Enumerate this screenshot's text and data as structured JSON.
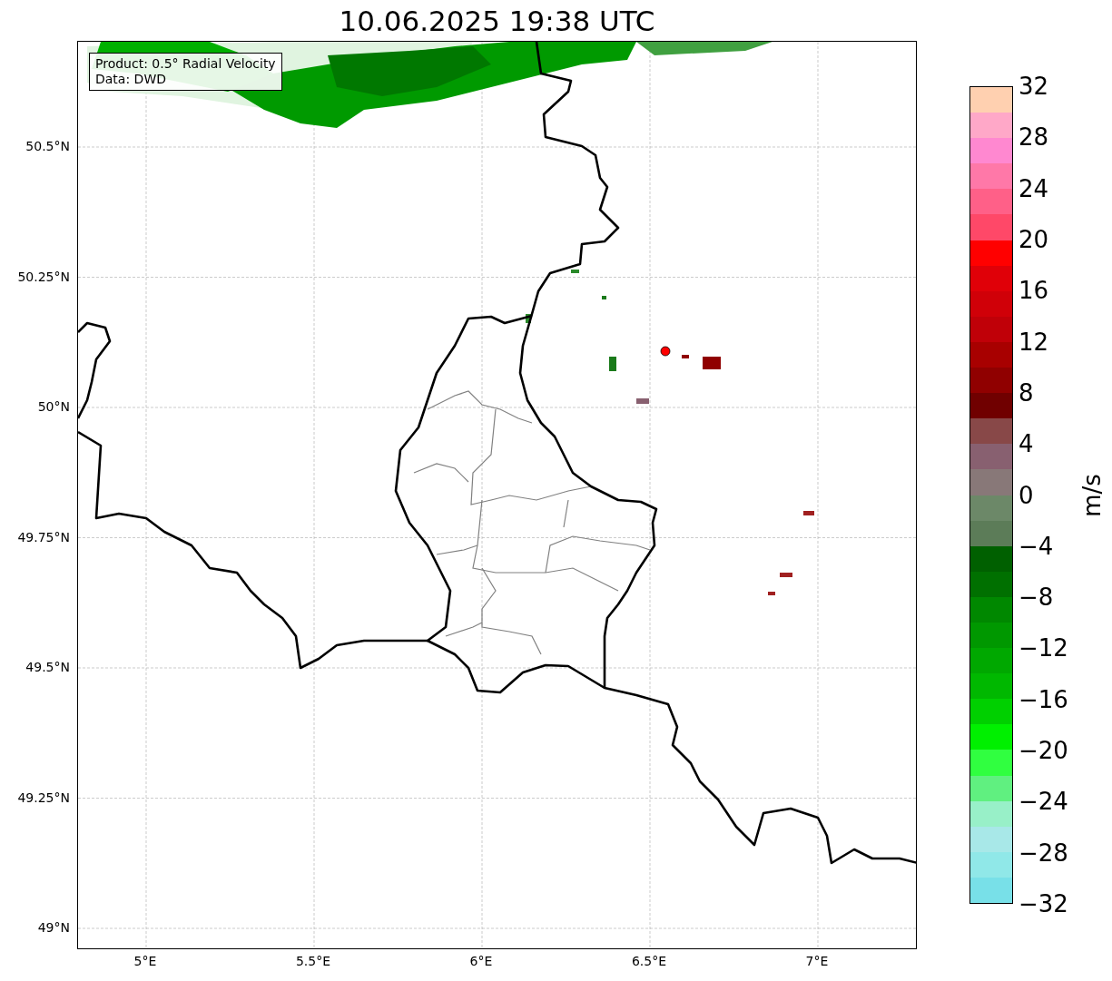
{
  "title": "10.06.2025 19:38 UTC",
  "info_box": {
    "lines": [
      "Product: 0.5° Radial Velocity",
      "Data: DWD"
    ]
  },
  "map": {
    "y_ticks": [
      "50.5°N",
      "50.25°N",
      "50°N",
      "49.75°N",
      "49.5°N",
      "49.25°N",
      "49°N"
    ],
    "x_ticks": [
      "5°E",
      "5.5°E",
      "6°E",
      "6.5°E",
      "7°E"
    ]
  },
  "colorbar": {
    "label": "m/s",
    "ticks": [
      "32",
      "28",
      "24",
      "20",
      "16",
      "12",
      "8",
      "4",
      "0",
      "−4",
      "−8",
      "−12",
      "−16",
      "−20",
      "−24",
      "−28",
      "−32"
    ],
    "segments": [
      {
        "color": "#ffd0b0"
      },
      {
        "color": "#ffa8c8"
      },
      {
        "color": "#ff88d0"
      },
      {
        "color": "#ff78a8"
      },
      {
        "color": "#ff6088"
      },
      {
        "color": "#ff4868"
      },
      {
        "color": "#ff0000"
      },
      {
        "color": "#e00008"
      },
      {
        "color": "#d00008"
      },
      {
        "color": "#c00008"
      },
      {
        "color": "#a80000"
      },
      {
        "color": "#900000"
      },
      {
        "color": "#700000"
      },
      {
        "color": "#884848"
      },
      {
        "color": "#886070"
      },
      {
        "color": "#887878"
      },
      {
        "color": "#6c8868"
      },
      {
        "color": "#5c7c58"
      },
      {
        "color": "#006000"
      },
      {
        "color": "#007000"
      },
      {
        "color": "#008800"
      },
      {
        "color": "#009800"
      },
      {
        "color": "#00a800"
      },
      {
        "color": "#00b800"
      },
      {
        "color": "#00d000"
      },
      {
        "color": "#00f000"
      },
      {
        "color": "#30ff40"
      },
      {
        "color": "#60f080"
      },
      {
        "color": "#98f0c8"
      },
      {
        "color": "#a8e8e8"
      },
      {
        "color": "#90e8e8"
      },
      {
        "color": "#78e0e8"
      }
    ]
  }
}
